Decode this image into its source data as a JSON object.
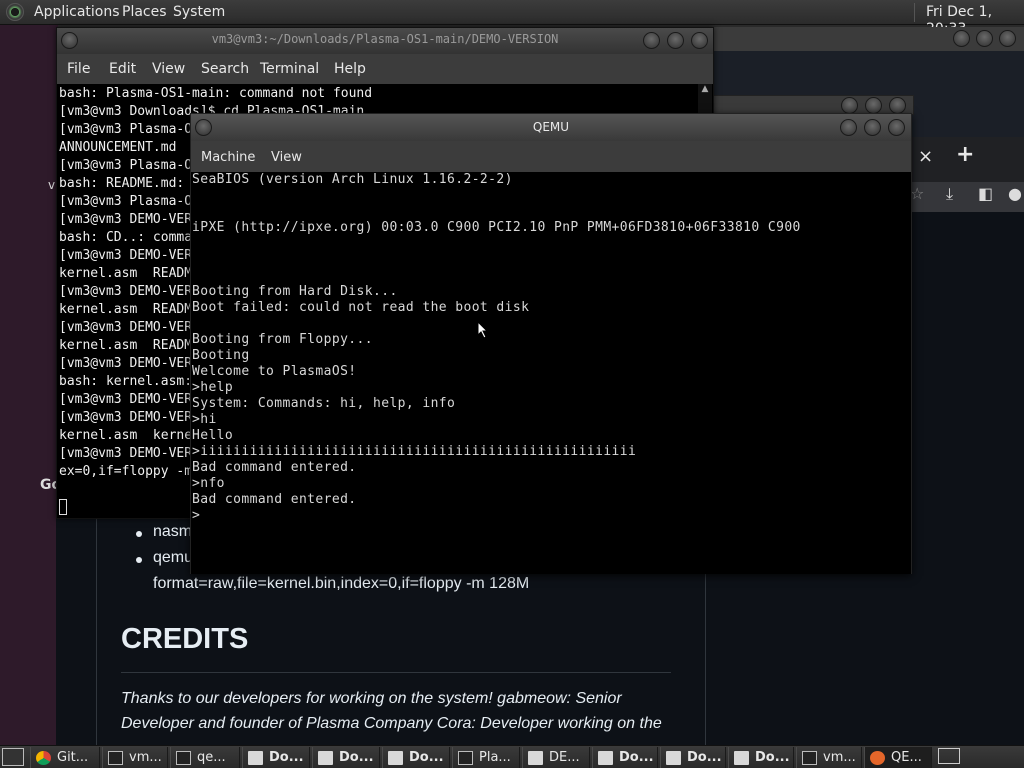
{
  "top_panel": {
    "menus": [
      "Applications",
      "Places",
      "System"
    ],
    "clock": "Fri Dec 1, 20:33"
  },
  "browser": {
    "tab_close_glyph": "×",
    "new_tab_glyph": "+",
    "readme": {
      "bullet_1": "nasm",
      "bullet_2": "qemu",
      "bullet_2_cont": "format=raw,file=kernel.bin,index=0,if=floppy -m 128M",
      "credits_heading": "CREDITS",
      "credits_line_1": "Thanks to our developers for working on the system! gabmeow: Senior",
      "credits_line_2": "Developer and founder of Plasma Company Cora: Developer working on the"
    },
    "side_fragment_go": "Go",
    "side_fragment_v": "v"
  },
  "terminal": {
    "title": "vm3@vm3:~/Downloads/Plasma-OS1-main/DEMO-VERSION",
    "menus": [
      "File",
      "Edit",
      "View",
      "Search",
      "Terminal",
      "Help"
    ],
    "lines": [
      "bash: Plasma-OS1-main: command not found",
      "[vm3@vm3 Downloads]$ cd Plasma-OS1-main",
      "[vm3@vm3 Plasma-O",
      "ANNOUNCEMENT.md",
      "[vm3@vm3 Plasma-O",
      "bash: README.md:",
      "[vm3@vm3 Plasma-O",
      "[vm3@vm3 DEMO-VER",
      "bash: CD..: comma",
      "[vm3@vm3 DEMO-VER",
      "kernel.asm  READM",
      "[vm3@vm3 DEMO-VER",
      "kernel.asm  READM",
      "[vm3@vm3 DEMO-VER",
      "kernel.asm  READM",
      "[vm3@vm3 DEMO-VER",
      "bash: kernel.asm:",
      "[vm3@vm3 DEMO-VER",
      "[vm3@vm3 DEMO-VER",
      "kernel.asm  kerne",
      "[vm3@vm3 DEMO-VER",
      "ex=0,if=floppy -m"
    ]
  },
  "qemu": {
    "title": "QEMU",
    "menus": [
      "Machine",
      "View"
    ],
    "lines": [
      "SeaBIOS (version Arch Linux 1.16.2-2-2)",
      "",
      "",
      "iPXE (http://ipxe.org) 00:03.0 C900 PCI2.10 PnP PMM+06FD3810+06F33810 C900",
      "",
      "",
      "",
      "Booting from Hard Disk...",
      "Boot failed: could not read the boot disk",
      "",
      "Booting from Floppy...",
      "Booting",
      "Welcome to PlasmaOS!",
      ">help",
      "System: Commands: hi, help, info",
      ">hi",
      "Hello",
      ">iiiiiiiiiiiiiiiiiiiiiiiiiiiiiiiiiiiiiiiiiiiiiiiiiiiii",
      "Bad command entered.",
      ">nfo",
      "Bad command entered.",
      ">"
    ]
  },
  "taskbar": {
    "items": [
      {
        "icon": "chrome-icon",
        "label": "Git...",
        "bold": false,
        "active": false
      },
      {
        "icon": "terminal-icon",
        "label": "vm...",
        "bold": false,
        "active": false
      },
      {
        "icon": "terminal-icon",
        "label": "qe...",
        "bold": false,
        "active": false
      },
      {
        "icon": "folder-icon",
        "label": "Do...",
        "bold": true,
        "active": false
      },
      {
        "icon": "folder-icon",
        "label": "Do...",
        "bold": true,
        "active": false
      },
      {
        "icon": "folder-icon",
        "label": "Do...",
        "bold": true,
        "active": false
      },
      {
        "icon": "terminal-icon",
        "label": "Pla...",
        "bold": false,
        "active": false
      },
      {
        "icon": "folder-icon",
        "label": "DE...",
        "bold": false,
        "active": false
      },
      {
        "icon": "folder-icon",
        "label": "Do...",
        "bold": true,
        "active": false
      },
      {
        "icon": "folder-icon",
        "label": "Do...",
        "bold": true,
        "active": false
      },
      {
        "icon": "folder-icon",
        "label": "Do...",
        "bold": true,
        "active": false
      },
      {
        "icon": "terminal-icon",
        "label": "vm...",
        "bold": false,
        "active": false
      },
      {
        "icon": "qemu-icon",
        "label": "QE...",
        "bold": false,
        "active": true
      }
    ]
  }
}
